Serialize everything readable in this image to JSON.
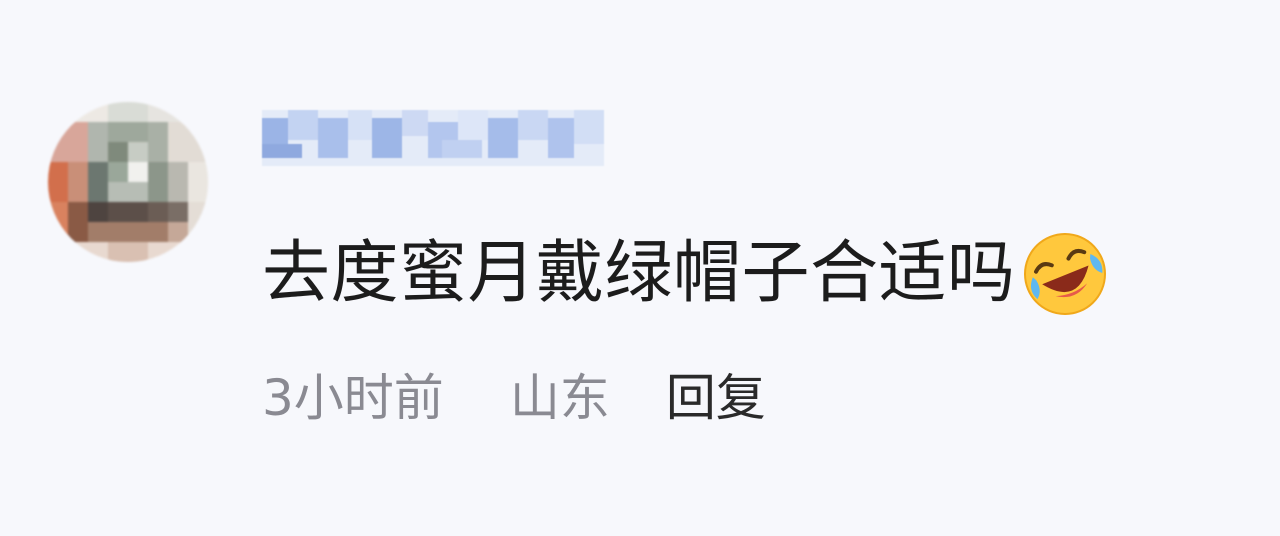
{
  "comment": {
    "text": "去度蜜月戴绿帽子合适吗",
    "emoji": "laughing-crying-emoji",
    "time": "3小时前",
    "location": "山东",
    "reply_label": "回复"
  },
  "colors": {
    "background": "#f7f8fc",
    "text": "#1c1c1c",
    "meta": "#8a8a92",
    "username_mosaic": "#c8d8f4"
  }
}
